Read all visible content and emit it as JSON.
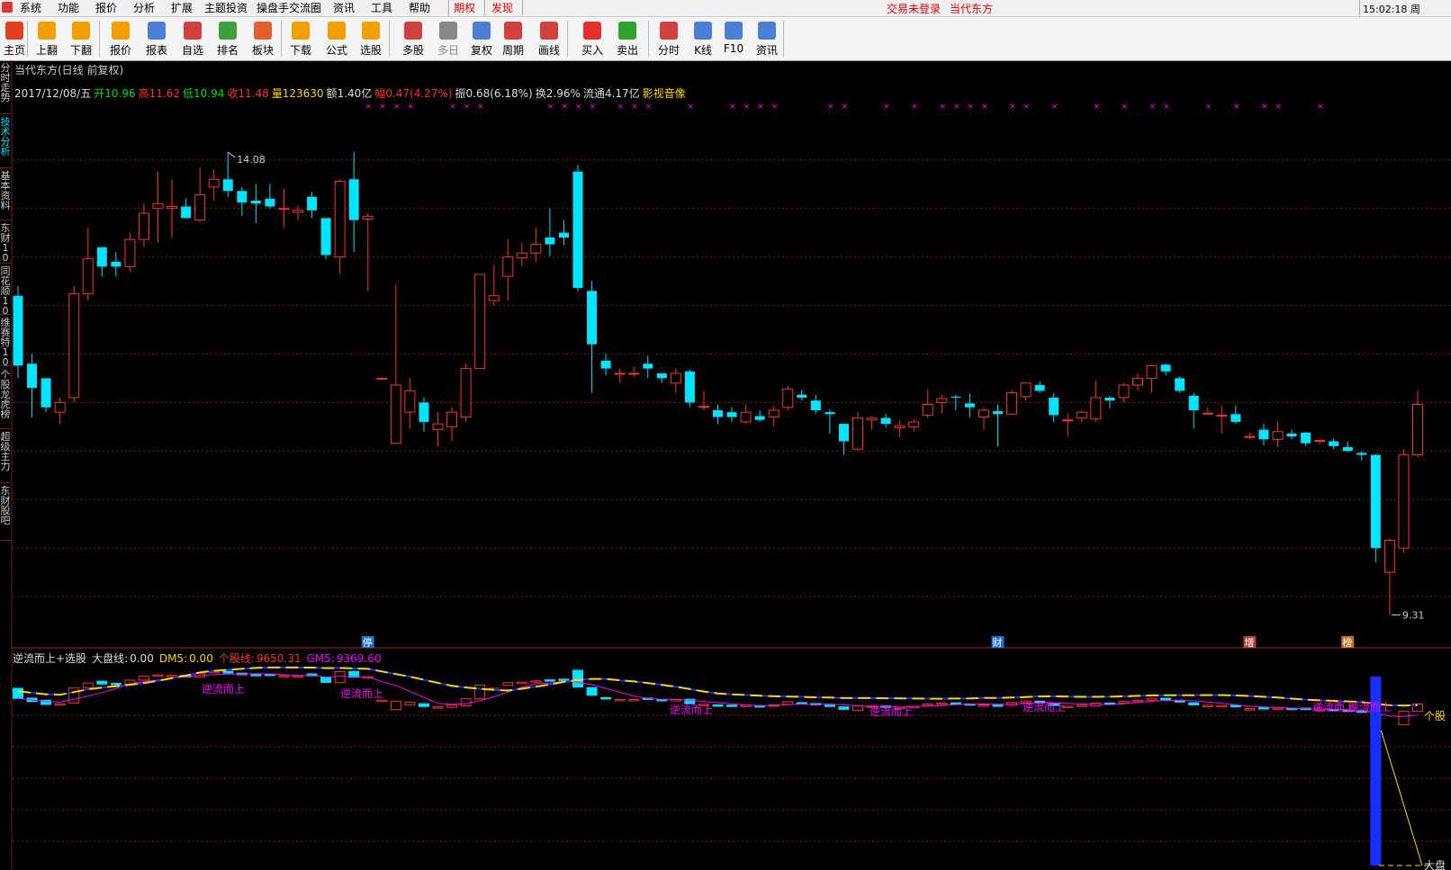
{
  "menu": {
    "items": [
      "系统",
      "功能",
      "报价",
      "分析",
      "扩展",
      "主题投资",
      "操盘手交流圈",
      "资讯",
      "工具",
      "帮助"
    ],
    "tabs": [
      "期权",
      "发现"
    ],
    "login_status": "交易未登录",
    "stock_name": "当代东方",
    "clock": "15:02:18 周"
  },
  "toolbar": {
    "buttons": [
      {
        "label": "主页",
        "icon": "home-icon",
        "color": "#e04020"
      },
      {
        "label": "上翻",
        "icon": "arrow-up-icon",
        "color": "#f0a000"
      },
      {
        "label": "下翻",
        "icon": "arrow-down-icon",
        "color": "#f0a000"
      },
      {
        "label": "报价",
        "icon": "yen-icon",
        "color": "#f0a000"
      },
      {
        "label": "报表",
        "icon": "report-icon",
        "color": "#4a7fd4"
      },
      {
        "label": "自选",
        "icon": "f6-icon",
        "color": "#d04040"
      },
      {
        "label": "排名",
        "icon": "ranking-icon",
        "color": "#40a040"
      },
      {
        "label": "板块",
        "icon": "sector-icon",
        "color": "#e06030"
      },
      {
        "label": "下载",
        "icon": "download-icon",
        "color": "#f0a000"
      },
      {
        "label": "公式",
        "icon": "formula-icon",
        "color": "#f0a000"
      },
      {
        "label": "选股",
        "icon": "stock-pick-icon",
        "color": "#f0a000"
      },
      {
        "label": "多股",
        "icon": "multi-stock-icon",
        "color": "#d04040"
      },
      {
        "label": "多日",
        "icon": "clock-icon",
        "color": "#888888"
      },
      {
        "label": "复权",
        "icon": "adjust-icon",
        "color": "#4a7fd4"
      },
      {
        "label": "周期",
        "icon": "period-icon",
        "color": "#d04040"
      },
      {
        "label": "画线",
        "icon": "draw-line-icon",
        "color": "#d04040"
      },
      {
        "label": "买入",
        "icon": "buy-icon",
        "color": "#e03030"
      },
      {
        "label": "卖出",
        "icon": "sell-icon",
        "color": "#30a030"
      },
      {
        "label": "分时",
        "icon": "intraday-icon",
        "color": "#d04040"
      },
      {
        "label": "K线",
        "icon": "kline-icon",
        "color": "#4a7fd4"
      },
      {
        "label": "F10",
        "icon": "f10-icon",
        "color": "#4a7fd4"
      },
      {
        "label": "资讯",
        "icon": "news-icon",
        "color": "#4a7fd4"
      }
    ]
  },
  "side_tabs": [
    {
      "label": "分时走势",
      "active": false
    },
    {
      "label": "技术分析",
      "active": true
    },
    {
      "label": "基本资料",
      "active": false
    },
    {
      "label": "东财10",
      "active": false
    },
    {
      "label": "同花顺10",
      "active": false
    },
    {
      "label": "维赛特10",
      "active": false
    },
    {
      "label": "个股龙虎榜",
      "active": false
    },
    {
      "label": "超级主力",
      "active": false
    },
    {
      "label": "东财股吧",
      "active": false
    }
  ],
  "chart_title": "当代东方(日线 前复权)",
  "quote": {
    "date": "2017/12/08/五",
    "open_label": "开",
    "open": "10.96",
    "high_label": "高",
    "high": "11.62",
    "low_label": "低",
    "low": "10.94",
    "close_label": "收",
    "close": "11.48",
    "volume_label": "量",
    "volume": "123630",
    "amount_label": "额",
    "amount": "1.40亿",
    "change_label": "幅",
    "change": "0.47(4.27%)",
    "amplitude_label": "振",
    "amplitude": "0.68(6.18%)",
    "turnover_label": "换",
    "turnover": "2.96%",
    "float_label": "流通",
    "float": "4.17亿",
    "concept": "影视音像"
  },
  "chart_data": {
    "type": "candlestick",
    "ylim": [
      9.0,
      14.6
    ],
    "candles": [
      {
        "o": 12.6,
        "h": 12.7,
        "l": 11.75,
        "c": 11.88
      },
      {
        "o": 11.9,
        "h": 12.0,
        "l": 11.35,
        "c": 11.65
      },
      {
        "o": 11.75,
        "h": 11.75,
        "l": 11.4,
        "c": 11.45
      },
      {
        "o": 11.4,
        "h": 11.55,
        "l": 11.28,
        "c": 11.5
      },
      {
        "o": 11.55,
        "h": 12.7,
        "l": 11.5,
        "c": 12.62
      },
      {
        "o": 12.62,
        "h": 13.3,
        "l": 12.55,
        "c": 12.98
      },
      {
        "o": 13.1,
        "h": 13.1,
        "l": 12.8,
        "c": 12.9
      },
      {
        "o": 12.95,
        "h": 13.05,
        "l": 12.8,
        "c": 12.9
      },
      {
        "o": 12.9,
        "h": 13.25,
        "l": 12.85,
        "c": 13.18
      },
      {
        "o": 13.18,
        "h": 13.55,
        "l": 13.1,
        "c": 13.45
      },
      {
        "o": 13.5,
        "h": 13.88,
        "l": 13.15,
        "c": 13.55
      },
      {
        "o": 13.5,
        "h": 13.8,
        "l": 13.2,
        "c": 13.52
      },
      {
        "o": 13.52,
        "h": 13.6,
        "l": 13.4,
        "c": 13.4
      },
      {
        "o": 13.38,
        "h": 13.92,
        "l": 13.36,
        "c": 13.64
      },
      {
        "o": 13.72,
        "h": 13.9,
        "l": 13.58,
        "c": 13.8
      },
      {
        "o": 13.8,
        "h": 14.08,
        "l": 13.62,
        "c": 13.68
      },
      {
        "o": 13.68,
        "h": 13.72,
        "l": 13.42,
        "c": 13.56
      },
      {
        "o": 13.58,
        "h": 13.75,
        "l": 13.35,
        "c": 13.55
      },
      {
        "o": 13.6,
        "h": 13.75,
        "l": 13.5,
        "c": 13.52
      },
      {
        "o": 13.5,
        "h": 13.7,
        "l": 13.3,
        "c": 13.5
      },
      {
        "o": 13.46,
        "h": 13.53,
        "l": 13.38,
        "c": 13.48
      },
      {
        "o": 13.62,
        "h": 13.67,
        "l": 13.4,
        "c": 13.48
      },
      {
        "o": 13.4,
        "h": 13.4,
        "l": 12.98,
        "c": 13.02
      },
      {
        "o": 13.0,
        "h": 13.8,
        "l": 12.82,
        "c": 13.78
      },
      {
        "o": 13.8,
        "h": 14.08,
        "l": 13.05,
        "c": 13.38
      },
      {
        "o": 13.39,
        "h": 13.45,
        "l": 12.65,
        "c": 13.42
      },
      {
        "o": 11.75,
        "h": 11.75,
        "l": 11.75,
        "c": 11.75
      },
      {
        "o": 11.08,
        "h": 12.72,
        "l": 11.08,
        "c": 11.68
      },
      {
        "o": 11.4,
        "h": 11.75,
        "l": 11.23,
        "c": 11.62
      },
      {
        "o": 11.5,
        "h": 11.55,
        "l": 11.2,
        "c": 11.3
      },
      {
        "o": 11.22,
        "h": 11.4,
        "l": 11.05,
        "c": 11.28
      },
      {
        "o": 11.25,
        "h": 11.45,
        "l": 11.1,
        "c": 11.4
      },
      {
        "o": 11.35,
        "h": 11.9,
        "l": 11.3,
        "c": 11.85
      },
      {
        "o": 11.85,
        "h": 12.82,
        "l": 11.85,
        "c": 12.82
      },
      {
        "o": 12.55,
        "h": 12.92,
        "l": 12.5,
        "c": 12.6
      },
      {
        "o": 12.8,
        "h": 13.18,
        "l": 12.55,
        "c": 13.0
      },
      {
        "o": 12.99,
        "h": 13.15,
        "l": 12.9,
        "c": 13.04
      },
      {
        "o": 13.04,
        "h": 13.3,
        "l": 12.95,
        "c": 13.13
      },
      {
        "o": 13.2,
        "h": 13.5,
        "l": 13.01,
        "c": 13.13
      },
      {
        "o": 13.25,
        "h": 13.38,
        "l": 13.12,
        "c": 13.2
      },
      {
        "o": 13.88,
        "h": 13.95,
        "l": 12.65,
        "c": 12.68
      },
      {
        "o": 12.65,
        "h": 12.75,
        "l": 11.6,
        "c": 12.1
      },
      {
        "o": 11.93,
        "h": 12.0,
        "l": 11.78,
        "c": 11.85
      },
      {
        "o": 11.8,
        "h": 11.85,
        "l": 11.7,
        "c": 11.8
      },
      {
        "o": 11.8,
        "h": 11.87,
        "l": 11.76,
        "c": 11.8
      },
      {
        "o": 11.9,
        "h": 11.98,
        "l": 11.75,
        "c": 11.85
      },
      {
        "o": 11.8,
        "h": 11.8,
        "l": 11.7,
        "c": 11.75
      },
      {
        "o": 11.7,
        "h": 11.85,
        "l": 11.6,
        "c": 11.8
      },
      {
        "o": 11.82,
        "h": 11.84,
        "l": 11.45,
        "c": 11.5
      },
      {
        "o": 11.46,
        "h": 11.62,
        "l": 11.42,
        "c": 11.46
      },
      {
        "o": 11.42,
        "h": 11.48,
        "l": 11.28,
        "c": 11.35
      },
      {
        "o": 11.4,
        "h": 11.45,
        "l": 11.3,
        "c": 11.35
      },
      {
        "o": 11.3,
        "h": 11.48,
        "l": 11.28,
        "c": 11.4
      },
      {
        "o": 11.36,
        "h": 11.42,
        "l": 11.3,
        "c": 11.32
      },
      {
        "o": 11.35,
        "h": 11.46,
        "l": 11.25,
        "c": 11.42
      },
      {
        "o": 11.45,
        "h": 11.67,
        "l": 11.42,
        "c": 11.64
      },
      {
        "o": 11.58,
        "h": 11.63,
        "l": 11.52,
        "c": 11.55
      },
      {
        "o": 11.52,
        "h": 11.58,
        "l": 11.38,
        "c": 11.42
      },
      {
        "o": 11.4,
        "h": 11.43,
        "l": 11.18,
        "c": 11.38
      },
      {
        "o": 11.28,
        "h": 11.28,
        "l": 10.96,
        "c": 11.1
      },
      {
        "o": 11.02,
        "h": 11.4,
        "l": 11.0,
        "c": 11.34
      },
      {
        "o": 11.32,
        "h": 11.36,
        "l": 11.22,
        "c": 11.34
      },
      {
        "o": 11.34,
        "h": 11.38,
        "l": 11.24,
        "c": 11.28
      },
      {
        "o": 11.24,
        "h": 11.32,
        "l": 11.14,
        "c": 11.26
      },
      {
        "o": 11.25,
        "h": 11.33,
        "l": 11.2,
        "c": 11.3
      },
      {
        "o": 11.37,
        "h": 11.63,
        "l": 11.34,
        "c": 11.48
      },
      {
        "o": 11.5,
        "h": 11.58,
        "l": 11.38,
        "c": 11.54
      },
      {
        "o": 11.56,
        "h": 11.58,
        "l": 11.42,
        "c": 11.55
      },
      {
        "o": 11.49,
        "h": 11.59,
        "l": 11.35,
        "c": 11.45
      },
      {
        "o": 11.35,
        "h": 11.45,
        "l": 11.22,
        "c": 11.42
      },
      {
        "o": 11.41,
        "h": 11.48,
        "l": 11.05,
        "c": 11.38
      },
      {
        "o": 11.38,
        "h": 11.63,
        "l": 11.37,
        "c": 11.6
      },
      {
        "o": 11.56,
        "h": 11.7,
        "l": 11.52,
        "c": 11.7
      },
      {
        "o": 11.68,
        "h": 11.72,
        "l": 11.6,
        "c": 11.62
      },
      {
        "o": 11.55,
        "h": 11.6,
        "l": 11.3,
        "c": 11.37
      },
      {
        "o": 11.32,
        "h": 11.39,
        "l": 11.15,
        "c": 11.32
      },
      {
        "o": 11.34,
        "h": 11.42,
        "l": 11.3,
        "c": 11.4
      },
      {
        "o": 11.33,
        "h": 11.73,
        "l": 11.3,
        "c": 11.55
      },
      {
        "o": 11.55,
        "h": 11.57,
        "l": 11.44,
        "c": 11.52
      },
      {
        "o": 11.55,
        "h": 11.7,
        "l": 11.5,
        "c": 11.68
      },
      {
        "o": 11.68,
        "h": 11.8,
        "l": 11.62,
        "c": 11.75
      },
      {
        "o": 11.75,
        "h": 11.88,
        "l": 11.6,
        "c": 11.88
      },
      {
        "o": 11.89,
        "h": 11.9,
        "l": 11.78,
        "c": 11.82
      },
      {
        "o": 11.75,
        "h": 11.77,
        "l": 11.6,
        "c": 11.62
      },
      {
        "o": 11.57,
        "h": 11.6,
        "l": 11.23,
        "c": 11.42
      },
      {
        "o": 11.39,
        "h": 11.45,
        "l": 11.38,
        "c": 11.39
      },
      {
        "o": 11.37,
        "h": 11.47,
        "l": 11.18,
        "c": 11.37
      },
      {
        "o": 11.38,
        "h": 11.47,
        "l": 11.28,
        "c": 11.3
      },
      {
        "o": 11.15,
        "h": 11.19,
        "l": 11.12,
        "c": 11.15
      },
      {
        "o": 11.22,
        "h": 11.28,
        "l": 11.06,
        "c": 11.12
      },
      {
        "o": 11.12,
        "h": 11.3,
        "l": 11.04,
        "c": 11.2
      },
      {
        "o": 11.18,
        "h": 11.22,
        "l": 11.12,
        "c": 11.15
      },
      {
        "o": 11.19,
        "h": 11.19,
        "l": 11.05,
        "c": 11.08
      },
      {
        "o": 11.1,
        "h": 11.11,
        "l": 11.07,
        "c": 11.11
      },
      {
        "o": 11.1,
        "h": 11.13,
        "l": 11.02,
        "c": 11.05
      },
      {
        "o": 11.04,
        "h": 11.1,
        "l": 10.99,
        "c": 11.0
      },
      {
        "o": 10.98,
        "h": 11.0,
        "l": 10.9,
        "c": 10.96
      },
      {
        "o": 10.96,
        "h": 10.97,
        "l": 9.85,
        "c": 10.0
      },
      {
        "o": 9.75,
        "h": 10.1,
        "l": 9.31,
        "c": 10.08
      },
      {
        "o": 10.0,
        "h": 11.02,
        "l": 9.95,
        "c": 10.96
      },
      {
        "o": 10.96,
        "h": 11.62,
        "l": 10.94,
        "c": 11.48
      }
    ],
    "high_marker": "14.08",
    "low_marker": "9.31",
    "gridlines": [
      14.0,
      13.5,
      13.0,
      12.5,
      12.0,
      11.5,
      11.0,
      10.5,
      10.0,
      9.5
    ]
  },
  "event_markers": [
    {
      "label": "停",
      "bar": 25,
      "color": "#1a6fd0"
    },
    {
      "label": "财",
      "bar": 70,
      "color": "#1a6fd0"
    },
    {
      "label": "增",
      "bar": 88,
      "color": "#b0443c"
    },
    {
      "label": "榜",
      "bar": 95,
      "color": "#c07020"
    }
  ],
  "signal_marks": {
    "symbol": "×",
    "bars": [
      25,
      26,
      27,
      28,
      31,
      32,
      33,
      38,
      39,
      40,
      41,
      43,
      44,
      45,
      48,
      51,
      52,
      53,
      54,
      58,
      59,
      62,
      64,
      66,
      67,
      68,
      69,
      71,
      72,
      74,
      77,
      79,
      81,
      82,
      85,
      87,
      89,
      90,
      93
    ]
  },
  "indicator": {
    "name": "逆流而上+选股",
    "big_line_label": "大盘线:",
    "big_line_value": "0.00",
    "dm5_label": "DM5:",
    "dm5_value": "0.00",
    "stock_line_label": "个股线:",
    "stock_line_value": "9650.31",
    "gm5_label": "GM5:",
    "gm5_value": "9369.60",
    "labels": [
      "逆流而上",
      "逆流而上",
      "逆流而上",
      "逆流而上",
      "逆流而上",
      "逆流而上",
      "逆流而上"
    ],
    "end_label_stock": "个股",
    "end_label_market": "大盘"
  },
  "colors": {
    "up": "#ff3030",
    "down": "#00e5ff",
    "grid": "#7a1a1a",
    "magenta": "#ff00ff",
    "yellow": "#ffd700",
    "blue": "#1530ff"
  }
}
